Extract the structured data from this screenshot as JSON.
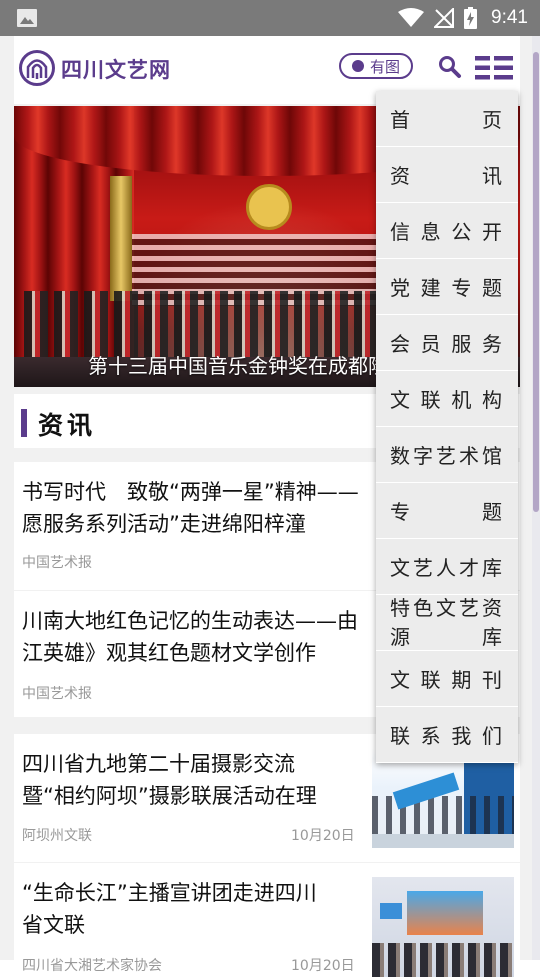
{
  "status_bar": {
    "time": "9:41"
  },
  "header": {
    "logo_text": "四川文艺网",
    "mode_button_label": "有图"
  },
  "banner": {
    "caption": "第十三届中国音乐金钟奖在成都隆"
  },
  "section": {
    "title": "资讯"
  },
  "news": [
    {
      "title_line1": "书写时代　致敬“两弹一星”精神——",
      "title_line2": "愿服务系列活动”走进绵阳梓潼",
      "source": "中国艺术报",
      "date": ""
    },
    {
      "title_line1": "川南大地红色记忆的生动表达——由",
      "title_line2": "江英雄》观其红色题材文学创作",
      "source": "中国艺术报",
      "date": ""
    },
    {
      "title_line1": "四川省九地第二十届摄影交流",
      "title_line2": "暨“相约阿坝”摄影联展活动在理",
      "source": "阿坝州文联",
      "date": "10月20日"
    },
    {
      "title_line1": "“生命长江”主播宣讲团走进四川",
      "title_line2": "省文联",
      "source": "四川省大湘艺术家协会",
      "date": "10月20日"
    }
  ],
  "menu": {
    "items": [
      "首　页",
      "资　讯",
      "信息公开",
      "党建专题",
      "会员服务",
      "文联机构",
      "数字艺术馆",
      "专　题",
      "文艺人才库",
      "特色文艺资源库",
      "文联期刊",
      "联系我们"
    ]
  },
  "colors": {
    "brand": "#5b3c8c",
    "status_bar": "#7a7a7a"
  }
}
